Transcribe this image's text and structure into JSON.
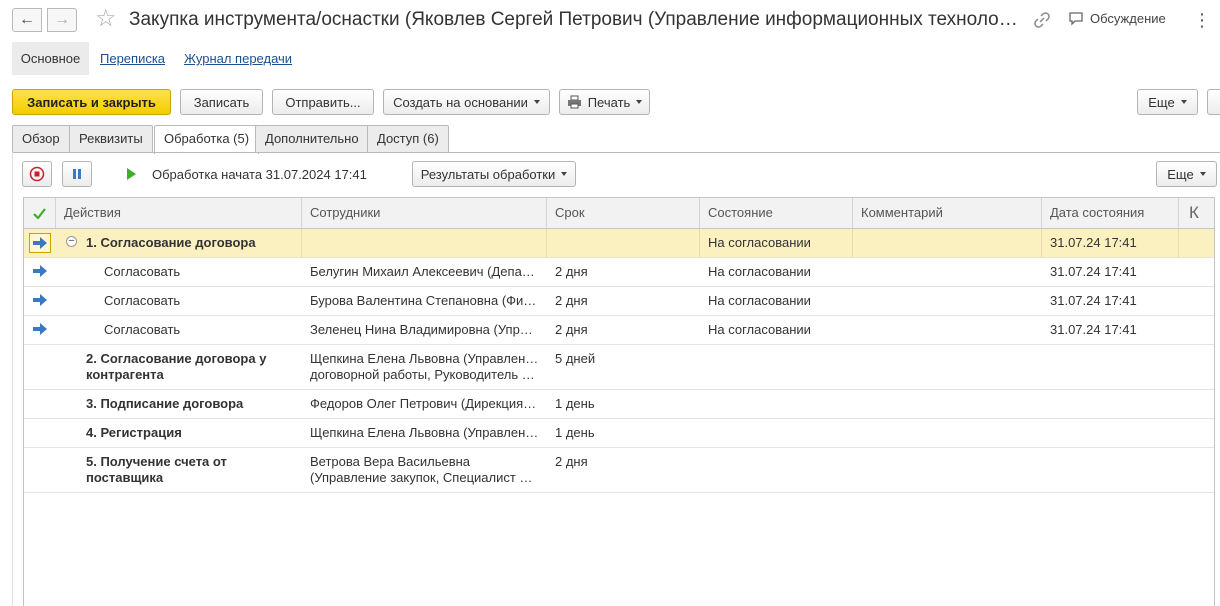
{
  "window": {
    "title": "Закупка инструмента/оснастки (Яковлев Сергей Петрович (Управление информационных технологий",
    "discussion_label": "Обсуждение"
  },
  "sections": {
    "main": "Основное",
    "correspondence": "Переписка",
    "transfer_log": "Журнал передачи"
  },
  "toolbar": {
    "save_close": "Записать и закрыть",
    "save": "Записать",
    "send": "Отправить...",
    "create_based": "Создать на основании",
    "print": "Печать",
    "more": "Еще"
  },
  "tabs": [
    {
      "label": "Обзор",
      "active": false
    },
    {
      "label": "Реквизиты",
      "active": false
    },
    {
      "label": "Обработка (5)",
      "active": true
    },
    {
      "label": "Дополнительно",
      "active": false
    },
    {
      "label": "Доступ (6)",
      "active": false
    }
  ],
  "process": {
    "status_text": "Обработка начата 31.07.2024 17:41",
    "results_button": "Результаты обработки",
    "more": "Еще"
  },
  "table": {
    "columns": [
      "Действия",
      "Сотрудники",
      "Срок",
      "Состояние",
      "Комментарий",
      "Дата состояния",
      "К"
    ],
    "rows": [
      {
        "action": "1. Согласование договора",
        "employee": "",
        "term": "",
        "state": "На согласовании",
        "comment": "",
        "date": "31.07.24 17:41"
      },
      {
        "action": "Согласовать",
        "employee": "Белугин Михаил Алексеевич (Депа…",
        "term": "2 дня",
        "state": "На согласовании",
        "comment": "",
        "date": "31.07.24 17:41"
      },
      {
        "action": "Согласовать",
        "employee": "Бурова Валентина Степановна (Фи…",
        "term": "2 дня",
        "state": "На согласовании",
        "comment": "",
        "date": "31.07.24 17:41"
      },
      {
        "action": "Согласовать",
        "employee": "Зеленец Нина Владимировна (Упра…",
        "term": "2 дня",
        "state": "На согласовании",
        "comment": "",
        "date": "31.07.24 17:41"
      },
      {
        "action_l1": "2. Согласование договора у",
        "action_l2": "контрагента",
        "employee_l1": "Щепкина Елена Львовна (Управлен…",
        "employee_l2": "договорной работы, Руководитель …",
        "term": "5 дней"
      },
      {
        "action": "3. Подписание договора",
        "employee": "Федоров Олег Петрович (Дирекция…",
        "term": "1 день"
      },
      {
        "action": "4. Регистрация",
        "employee": "Щепкина Елена Львовна (Управлен…",
        "term": "1 день"
      },
      {
        "action_l1": "5. Получение счета от",
        "action_l2": "поставщика",
        "employee_l1": "Ветрова Вера Васильевна",
        "employee_l2": "(Управление закупок, Специалист п…",
        "term": "2 дня"
      }
    ]
  }
}
